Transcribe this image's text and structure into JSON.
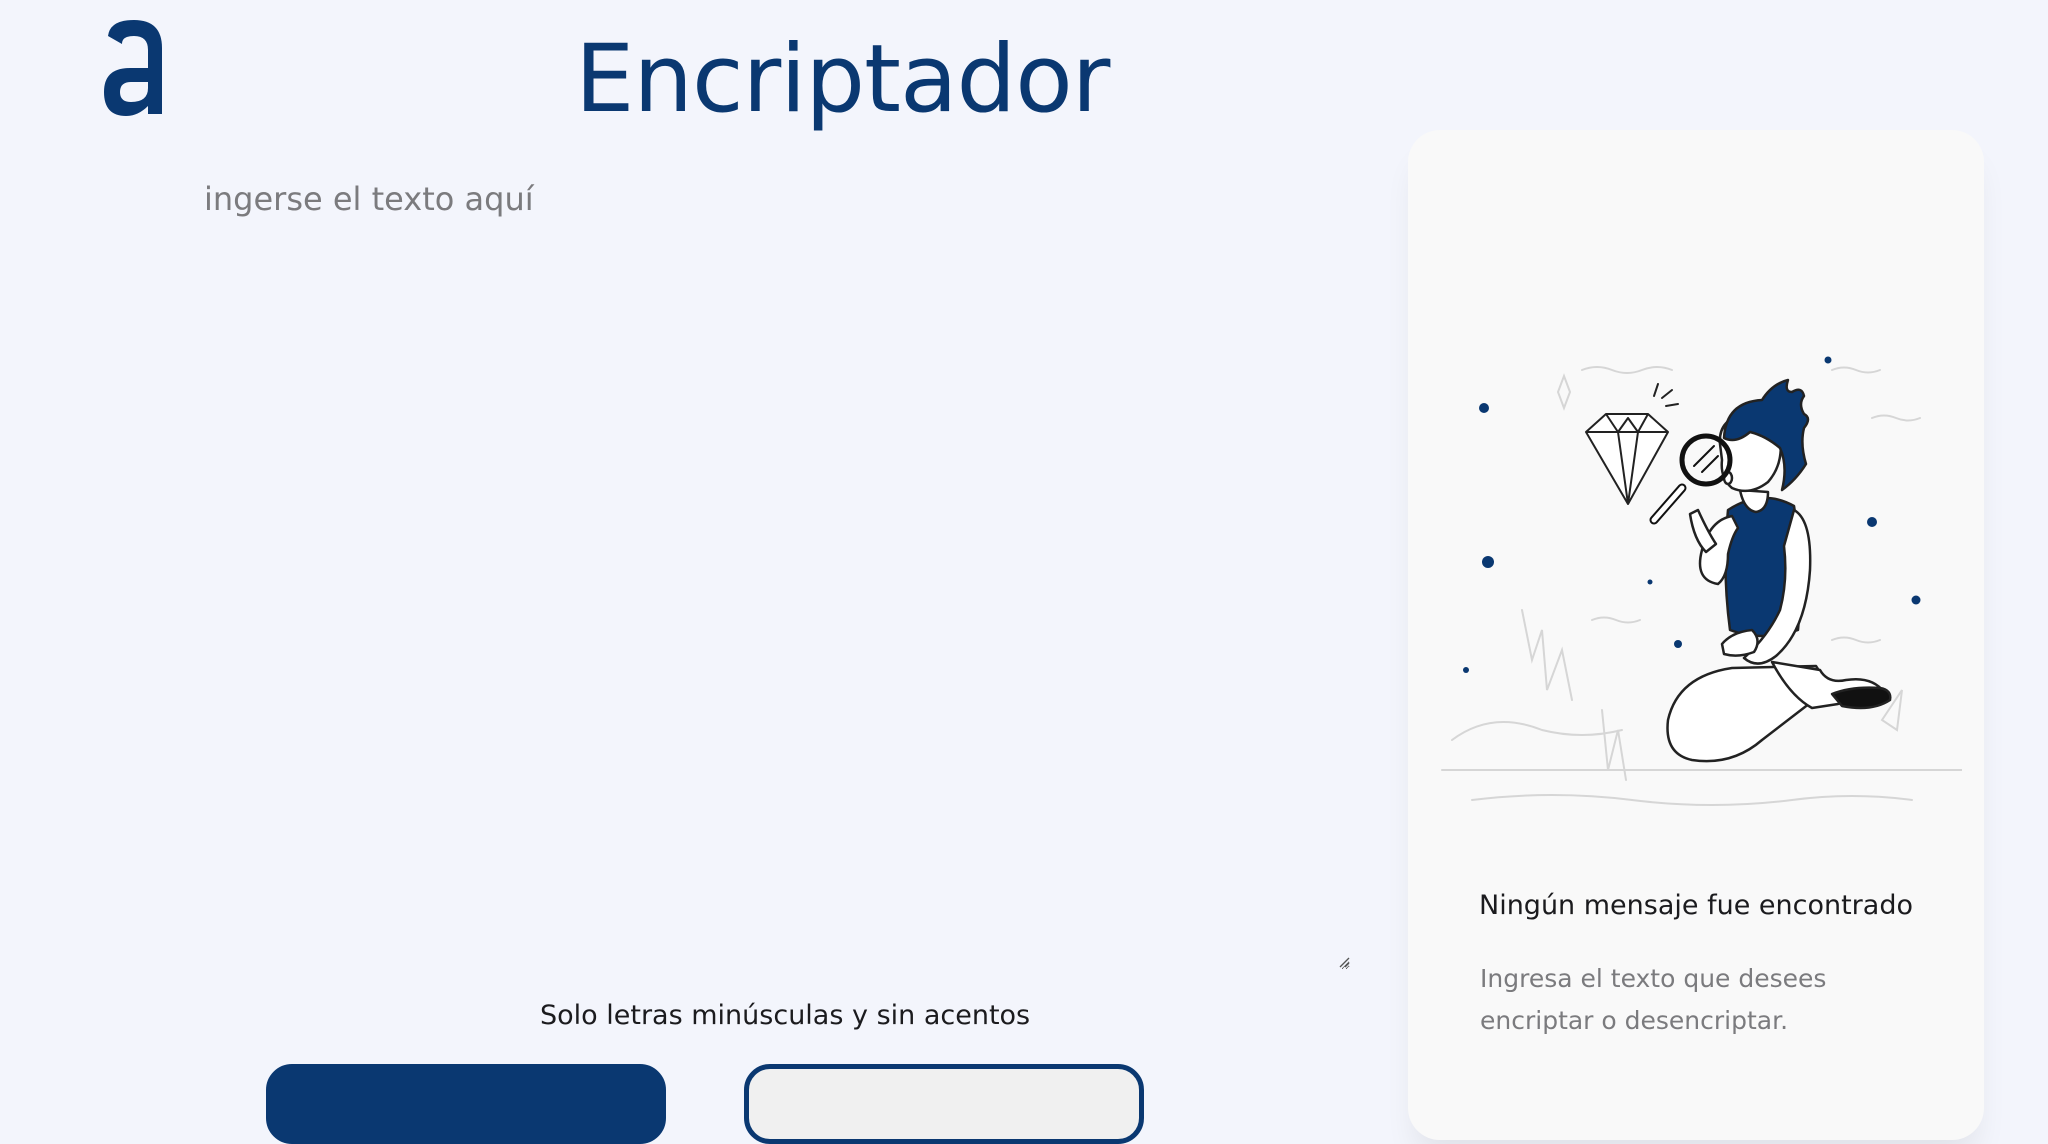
{
  "header": {
    "title": "Encriptador"
  },
  "logo": {
    "icon": "alura-a-logo-icon",
    "color": "#0a3871"
  },
  "editor": {
    "placeholder": "ingerse el texto aquí",
    "value": ""
  },
  "hint": {
    "text": "Solo letras minúsculas y sin acentos"
  },
  "buttons": {
    "encrypt_label": "",
    "decrypt_label": ""
  },
  "result_panel": {
    "illustration": "person-with-magnifying-glass-and-diamond-icon",
    "title": "Ningún mensaje fue encontrado",
    "text": "Ingresa el texto que desees encriptar o desencriptar."
  },
  "colors": {
    "accent": "#0a3871",
    "background": "#f3f5fc",
    "panel": "#f9f9f9"
  }
}
